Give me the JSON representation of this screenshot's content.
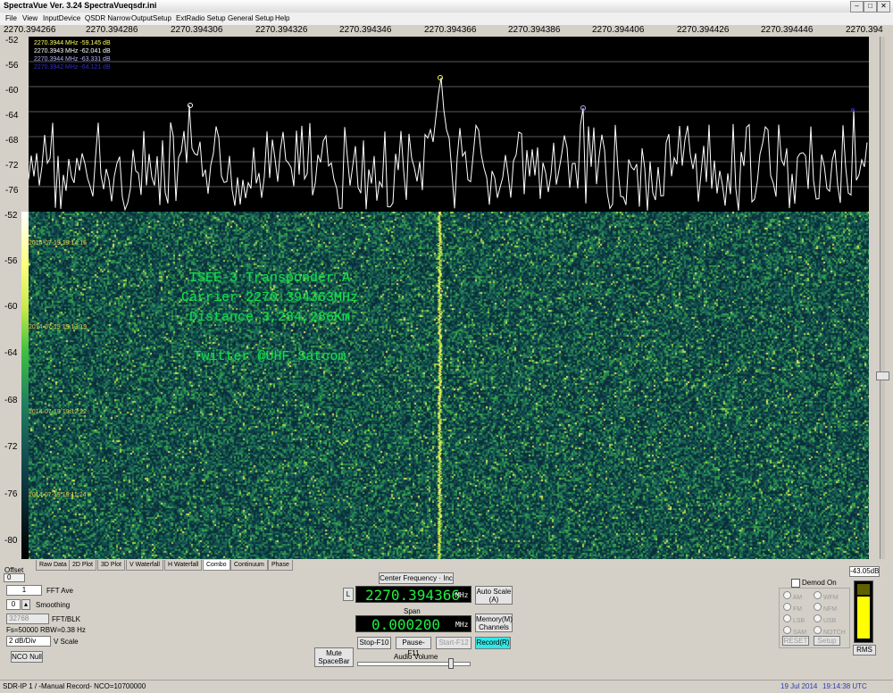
{
  "window": {
    "title": "SpectraVue Ver. 3.24  SpectraVueqsdr.ini",
    "app_icon": "SV"
  },
  "menu": [
    "File",
    "View",
    "InputDevice",
    "QSDR Narrow",
    "OutputSetup",
    "ExtRadio Setup",
    "General Setup",
    "Help"
  ],
  "freq_ticks": [
    "2270.394266",
    "2270.394286",
    "2270.394306",
    "2270.394326",
    "2270.394346",
    "2270.394366",
    "2270.394386",
    "2270.394406",
    "2270.394426",
    "2270.394446",
    "2270.394"
  ],
  "spectrum_y_labels": [
    "-52",
    "-56",
    "-60",
    "-64",
    "-68",
    "-72",
    "-76"
  ],
  "waterfall_y_labels": [
    "-52",
    "-56",
    "-60",
    "-64",
    "-68",
    "-72",
    "-76",
    "-80"
  ],
  "markers": [
    {
      "text": "2270.3944 MHz  -59.145 dB",
      "color": "#ffff60"
    },
    {
      "text": "2270.3943 MHz  -62.041 dB",
      "color": "#ffffff"
    },
    {
      "text": "2270.3944 MHz  -63.331 dB",
      "color": "#b0b0ff"
    },
    {
      "text": "2270.3942 MHz  -64.121 dB",
      "color": "#3030c0"
    }
  ],
  "timestamps": [
    "2014-07-19 19:14:16",
    "2014-07-19 19:13:19",
    "2014-07-19 19:12:22",
    "2014-07-19 19:11:24"
  ],
  "overlay_text": [
    "ISEE-3 Transponder A",
    "Carrier 2270.394363MHz",
    "Distance 3,284,286Km",
    "",
    "Twitter @UHF_Satcom"
  ],
  "tabs": [
    "Raw Data",
    "2D Plot",
    "3D Plot",
    "V Waterfall",
    "H Waterfall",
    "Combo",
    "Continuum",
    "Phase"
  ],
  "active_tab": "Combo",
  "left_controls": {
    "offset_label": "Offset",
    "offset_value": "0",
    "fft_ave_value": "1",
    "fft_ave_label": "FFT Ave",
    "smoothing_value": "0",
    "smoothing_label": "Smoothing",
    "fft_blk_value": "32768",
    "fft_blk_label": "FFT/BLK",
    "fs_rbw": "Fs=50000 RBW=0.38 Hz",
    "vscale_value": "2 dB/Div",
    "vscale_label": "V Scale",
    "nco_null": "NCO Null"
  },
  "center": {
    "center_freq_button": "Center Frequency · Inc",
    "l_button": "L",
    "center_freq_value": "2270.394366",
    "unit_mhz": "MHz",
    "auto_scale": "Auto Scale (A)",
    "span_label": "Span",
    "span_value": "0.000200",
    "memory_channels": "Memory(M) Channels",
    "mute": "Mute SpaceBar",
    "stop": "Stop-F10",
    "pause": "Pause-F11",
    "startf12": "Start-F12",
    "record": "Record(R)",
    "audio_volume": "Audio Volume"
  },
  "demod": {
    "demod_on": "Demod On",
    "modes_left": [
      "AM",
      "FM",
      "LSB",
      "SAM",
      "CWL"
    ],
    "modes_right": [
      "WFM",
      "NFM",
      "USB",
      "NOTCH",
      "CWU"
    ],
    "buttons": [
      "RESET",
      "Setup"
    ]
  },
  "level": {
    "value": "-43.05dB",
    "rms": "RMS"
  },
  "status": {
    "left": "SDR-IP 1  / -Manual Record-   NCO=10700000",
    "date": "19 Jul 2014",
    "time": "19:14:38 UTC"
  },
  "colors": {
    "trace": "#ffffff",
    "grid": "#5a5a5a",
    "lcd_green": "#20f040",
    "overlay_green": "#19d94a",
    "record_bg": "#30e8e8"
  }
}
